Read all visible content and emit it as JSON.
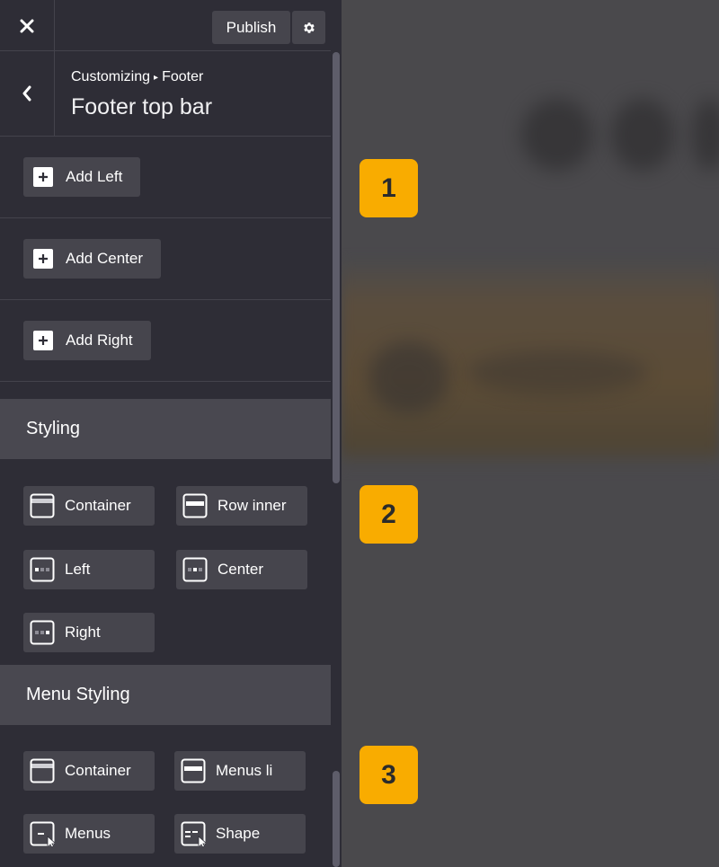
{
  "header": {
    "close_icon": "close-icon",
    "publish_label": "Publish",
    "settings_icon": "gear-icon"
  },
  "panel": {
    "breadcrumb_parent": "Customizing",
    "breadcrumb_current": "Footer",
    "title": "Footer top bar"
  },
  "add_buttons": [
    {
      "label": "Add Left"
    },
    {
      "label": "Add Center"
    },
    {
      "label": "Add Right"
    }
  ],
  "styling": {
    "heading": "Styling",
    "items": [
      {
        "label": "Container",
        "icon": "container-icon"
      },
      {
        "label": "Row inner",
        "icon": "row-inner-icon"
      },
      {
        "label": "Left",
        "icon": "align-left-icon"
      },
      {
        "label": "Center",
        "icon": "align-center-icon"
      },
      {
        "label": "Right",
        "icon": "align-right-icon"
      }
    ]
  },
  "menu_styling": {
    "heading": "Menu Styling",
    "items": [
      {
        "label": "Container",
        "icon": "container-icon"
      },
      {
        "label": "Menus li",
        "icon": "menus-li-icon"
      },
      {
        "label": "Menus",
        "icon": "menus-icon"
      },
      {
        "label": "Shape",
        "icon": "shape-icon"
      }
    ]
  },
  "badges": [
    "1",
    "2",
    "3"
  ],
  "colors": {
    "sidebar_bg": "#2e2d36",
    "button_bg": "#46454d",
    "section_header_bg": "#494850",
    "badge_bg": "#f9ac00",
    "preview_bg": "#4a494c"
  }
}
